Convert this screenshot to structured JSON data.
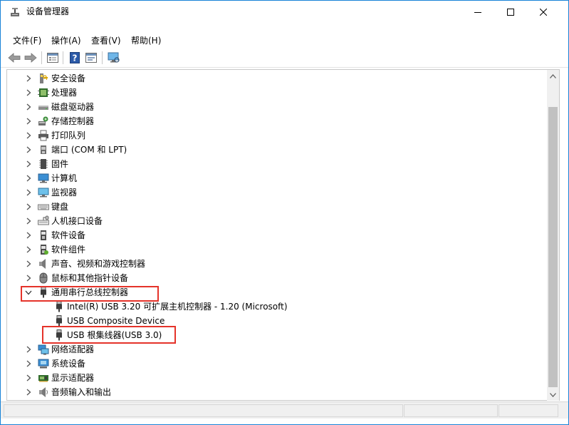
{
  "window": {
    "title": "设备管理器"
  },
  "menu": [
    {
      "label": "文件(F)"
    },
    {
      "label": "操作(A)"
    },
    {
      "label": "查看(V)"
    },
    {
      "label": "帮助(H)"
    }
  ],
  "toolbar": {
    "buttons": [
      {
        "icon": "back-arrow-icon"
      },
      {
        "icon": "forward-arrow-icon"
      },
      {
        "icon": "properties-icon"
      },
      {
        "icon": "help-icon"
      },
      {
        "icon": "update-driver-icon"
      },
      {
        "icon": "scan-hardware-icon"
      }
    ]
  },
  "tree": {
    "items": [
      {
        "label": "安全设备",
        "icon": "security-device-icon",
        "expanded": false,
        "level": 0
      },
      {
        "label": "处理器",
        "icon": "processor-icon",
        "expanded": false,
        "level": 0
      },
      {
        "label": "磁盘驱动器",
        "icon": "disk-drive-icon",
        "expanded": false,
        "level": 0
      },
      {
        "label": "存储控制器",
        "icon": "storage-controller-icon",
        "expanded": false,
        "level": 0
      },
      {
        "label": "打印队列",
        "icon": "printer-icon",
        "expanded": false,
        "level": 0
      },
      {
        "label": "端口 (COM 和 LPT)",
        "icon": "port-icon",
        "expanded": false,
        "level": 0
      },
      {
        "label": "固件",
        "icon": "firmware-icon",
        "expanded": false,
        "level": 0
      },
      {
        "label": "计算机",
        "icon": "computer-icon",
        "expanded": false,
        "level": 0
      },
      {
        "label": "监视器",
        "icon": "monitor-icon",
        "expanded": false,
        "level": 0
      },
      {
        "label": "键盘",
        "icon": "keyboard-icon",
        "expanded": false,
        "level": 0
      },
      {
        "label": "人机接口设备",
        "icon": "hid-icon",
        "expanded": false,
        "level": 0
      },
      {
        "label": "软件设备",
        "icon": "software-device-icon",
        "expanded": false,
        "level": 0
      },
      {
        "label": "软件组件",
        "icon": "software-component-icon",
        "expanded": false,
        "level": 0
      },
      {
        "label": "声音、视频和游戏控制器",
        "icon": "sound-icon",
        "expanded": false,
        "level": 0
      },
      {
        "label": "鼠标和其他指针设备",
        "icon": "mouse-icon",
        "expanded": false,
        "level": 0
      },
      {
        "label": "通用串行总线控制器",
        "icon": "usb-icon",
        "expanded": true,
        "level": 0
      },
      {
        "label": "Intel(R) USB 3.20 可扩展主机控制器 - 1.20 (Microsoft)",
        "icon": "usb-device-icon",
        "level": 1
      },
      {
        "label": "USB Composite Device",
        "icon": "usb-device-icon",
        "level": 1
      },
      {
        "label": "USB 根集线器(USB 3.0)",
        "icon": "usb-device-icon",
        "level": 1
      },
      {
        "label": "网络适配器",
        "icon": "network-adapter-icon",
        "expanded": false,
        "level": 0
      },
      {
        "label": "系统设备",
        "icon": "system-device-icon",
        "expanded": false,
        "level": 0
      },
      {
        "label": "显示适配器",
        "icon": "display-adapter-icon",
        "expanded": false,
        "level": 0
      },
      {
        "label": "音频输入和输出",
        "icon": "audio-io-icon",
        "expanded": false,
        "level": 0
      }
    ]
  },
  "highlights": [
    {
      "target": "通用串行总线控制器",
      "color": "#e5332a"
    },
    {
      "target": "USB 根集线器(USB 3.0)",
      "color": "#e5332a"
    }
  ],
  "colors": {
    "window_border": "#1883d7",
    "highlight": "#e5332a"
  }
}
